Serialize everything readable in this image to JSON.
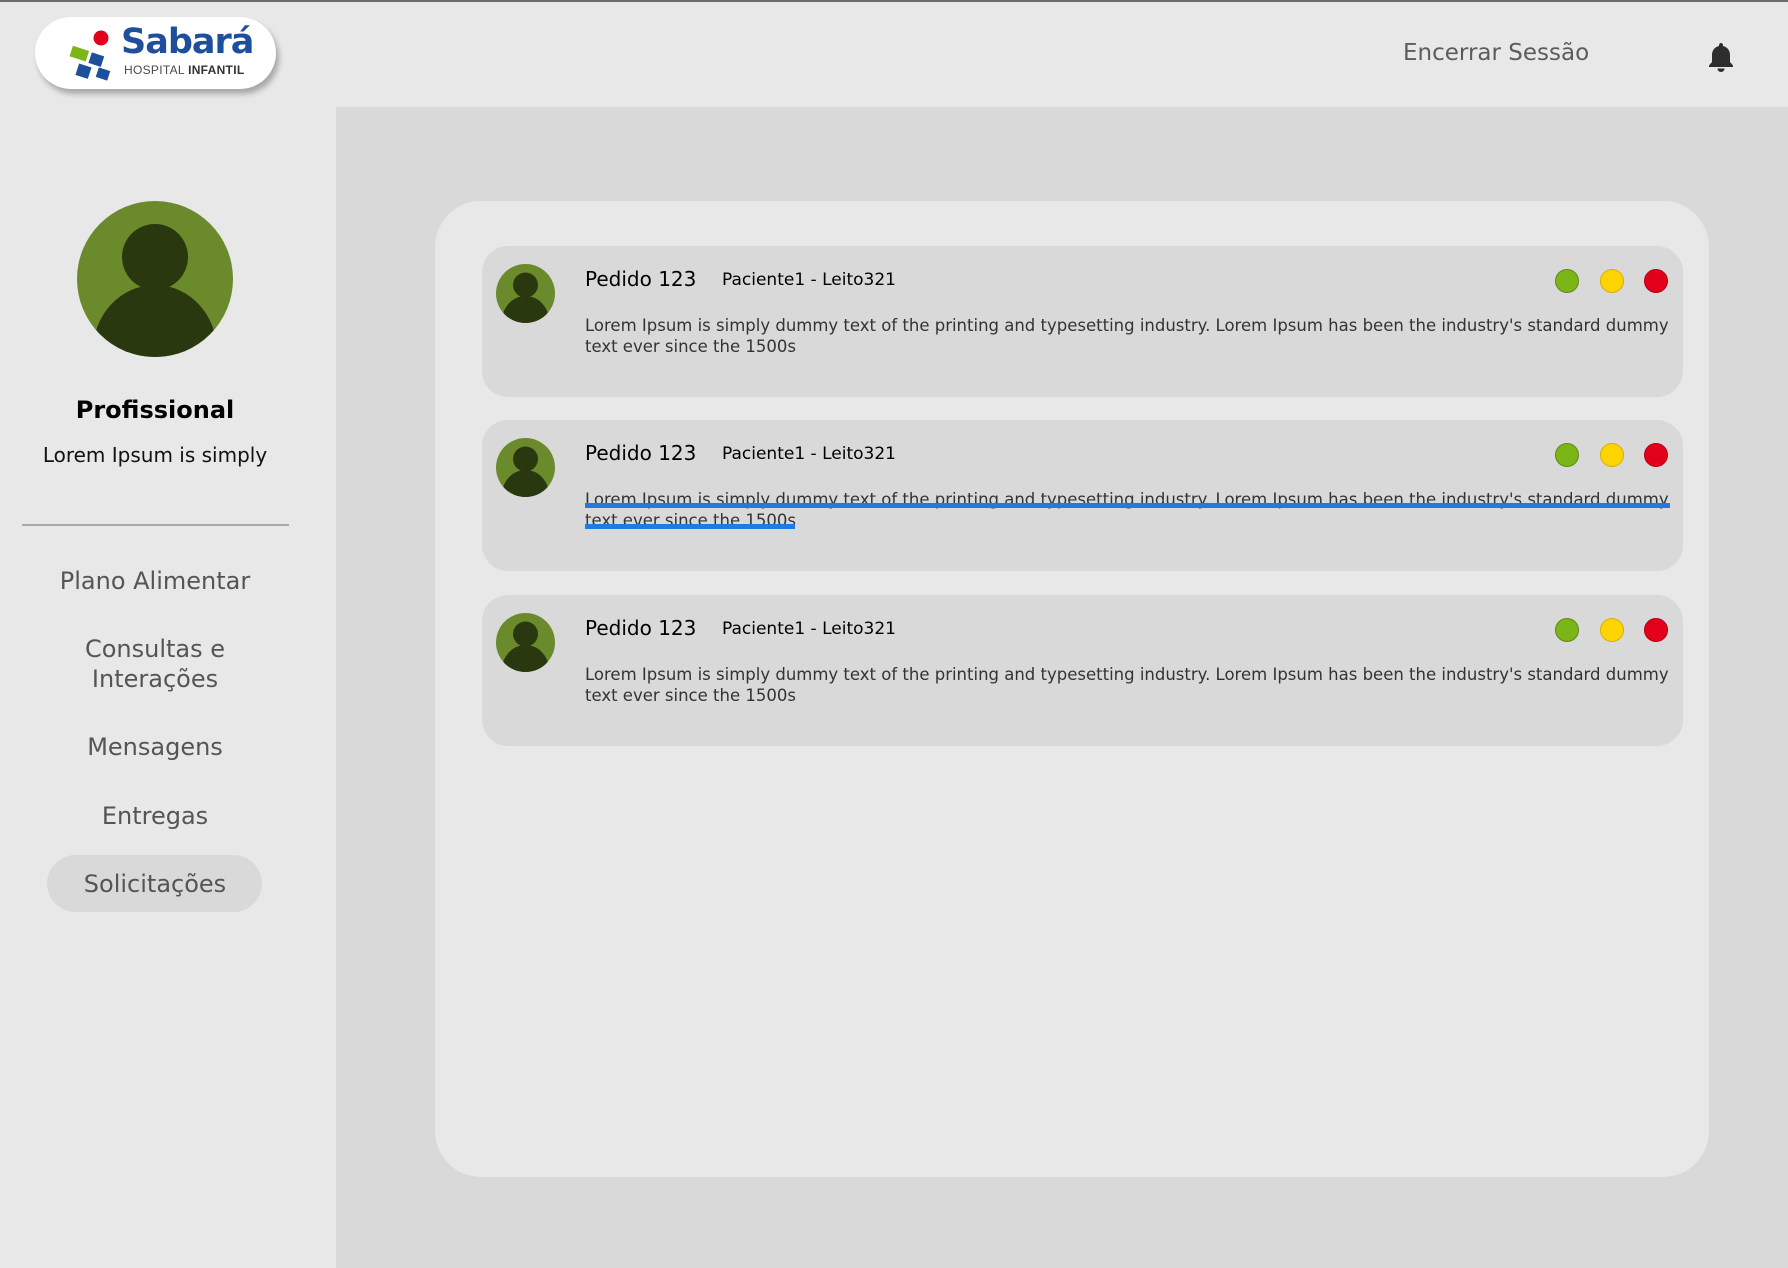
{
  "header": {
    "brand_name": "Sabará",
    "brand_sub_regular": "HOSPITAL",
    "brand_sub_bold": "INFANTIL",
    "logout_label": "Encerrar Sessão",
    "notification_icon": "bell-icon"
  },
  "profile": {
    "name": "Profissional",
    "subtitle": "Lorem Ipsum is simply"
  },
  "sidebar": {
    "items": [
      {
        "label": "Plano Alimentar"
      },
      {
        "label": "Consultas e Interações"
      },
      {
        "label": "Mensagens"
      },
      {
        "label": "Entregas"
      },
      {
        "label": "Solicitações",
        "active": true
      }
    ]
  },
  "requests": [
    {
      "title": "Pedido 123",
      "patient": "Paciente1 - Leito321",
      "description": "Lorem Ipsum is simply dummy text of the printing and typesetting industry. Lorem Ipsum has been the industry's standard dummy text ever since the 1500s"
    },
    {
      "title": "Pedido 123",
      "patient": "Paciente1 - Leito321",
      "description": "Lorem Ipsum is simply dummy text of the printing and typesetting industry. Lorem Ipsum has been the industry's standard dummy text ever since the 1500s",
      "highlighted": true
    },
    {
      "title": "Pedido 123",
      "patient": "Paciente1 - Leito321",
      "description": "Lorem Ipsum is simply dummy text of the printing and typesetting industry. Lorem Ipsum has been the industry's standard dummy text ever since the 1500s"
    }
  ],
  "colors": {
    "status_green": "#7cb518",
    "status_yellow": "#ffd400",
    "status_red": "#e3001b",
    "avatar_bg": "#6b8a2c",
    "avatar_figure": "#2a3810",
    "brand_blue": "#1d4f9c",
    "highlight_blue": "#1f7be0"
  }
}
